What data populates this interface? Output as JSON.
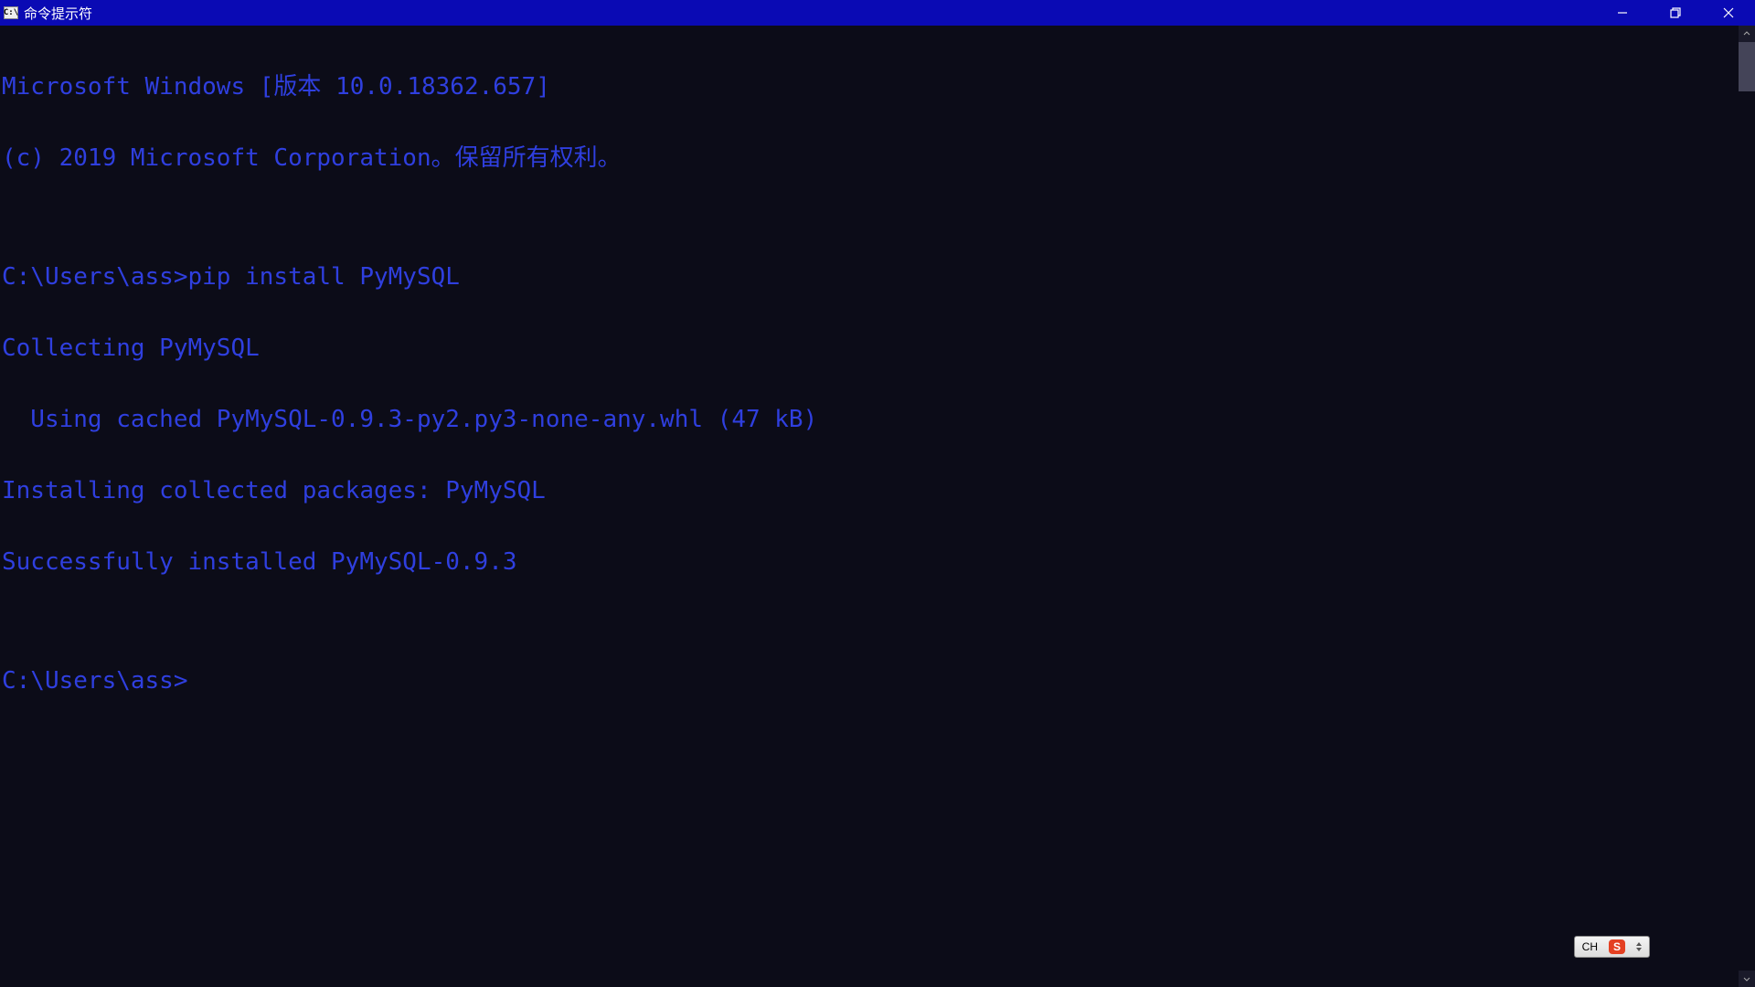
{
  "titlebar": {
    "icon_text": "C:\\",
    "title": "命令提示符"
  },
  "terminal": {
    "lines": [
      "Microsoft Windows [版本 10.0.18362.657]",
      "(c) 2019 Microsoft Corporation。保留所有权利。",
      "",
      "C:\\Users\\ass>pip install PyMySQL",
      "Collecting PyMySQL",
      "  Using cached PyMySQL-0.9.3-py2.py3-none-any.whl (47 kB)",
      "Installing collected packages: PyMySQL",
      "Successfully installed PyMySQL-0.9.3",
      "",
      "C:\\Users\\ass>"
    ]
  },
  "ime": {
    "lang": "CH",
    "logo": "S"
  }
}
